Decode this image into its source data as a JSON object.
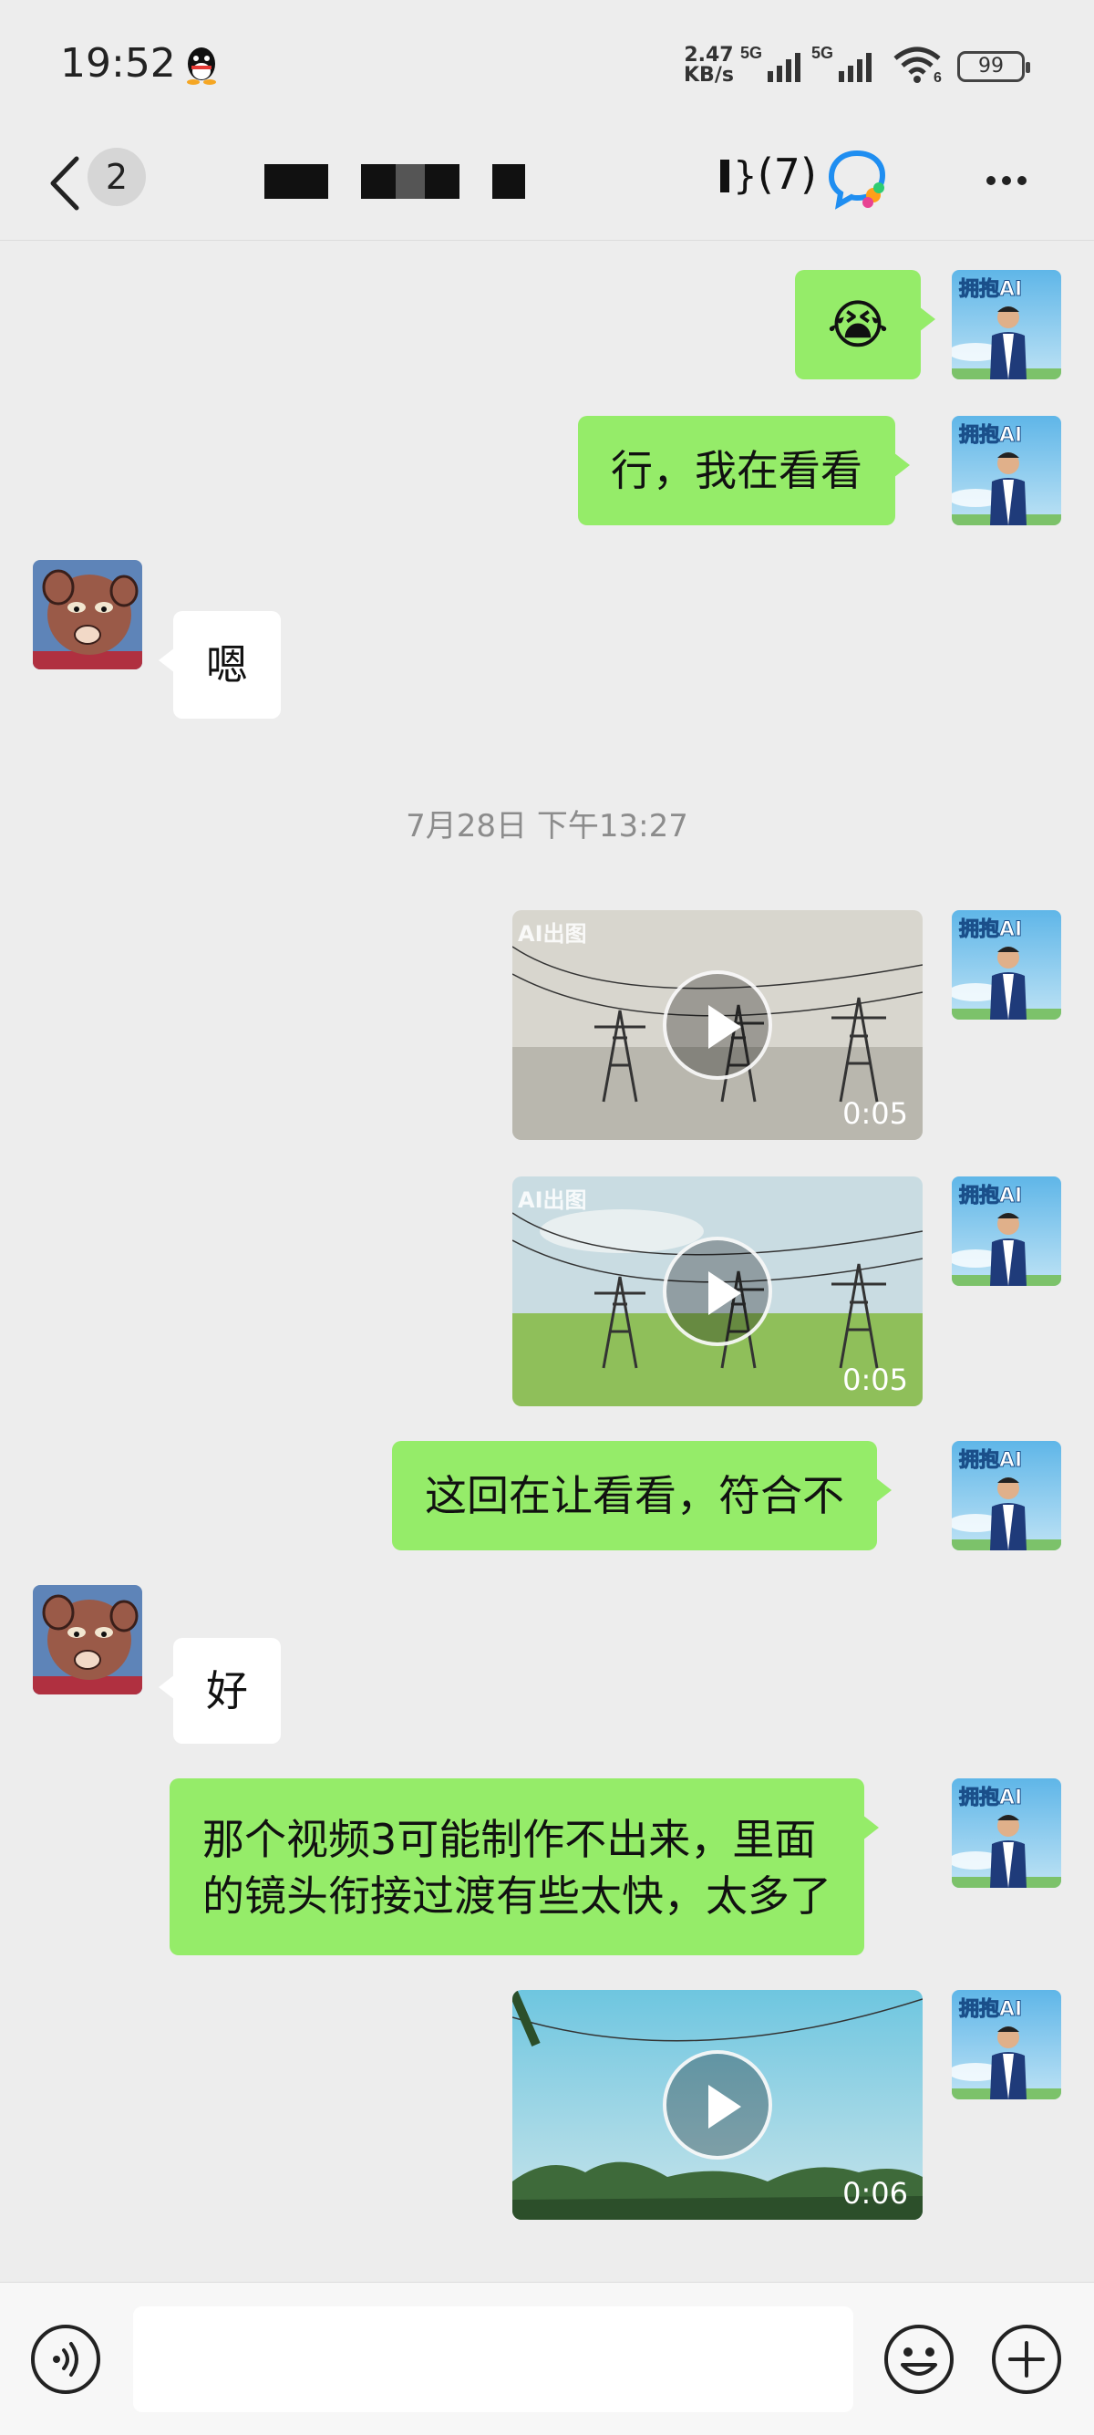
{
  "status_bar": {
    "time": "19:52",
    "net_speed_value": "2.47",
    "net_speed_unit": "KB/s",
    "sim1": "5G",
    "sim2": "5G",
    "wifi_sub": "6",
    "battery": "99"
  },
  "header": {
    "unread_count": "2",
    "title_suffix": "(7)"
  },
  "messages": [
    {
      "id": "m1",
      "side": "me",
      "type": "emoji",
      "emoji": "😭"
    },
    {
      "id": "m2",
      "side": "me",
      "type": "text",
      "text": "行，我在看看"
    },
    {
      "id": "m3",
      "side": "them",
      "type": "text",
      "text": "嗯"
    },
    {
      "id": "ts1",
      "type": "timestamp",
      "text": "7月28日 下午13:27"
    },
    {
      "id": "m4",
      "side": "me",
      "type": "video",
      "duration": "0:05",
      "watermark": "AI出图"
    },
    {
      "id": "m5",
      "side": "me",
      "type": "video",
      "duration": "0:05",
      "watermark": "AI出图"
    },
    {
      "id": "m6",
      "side": "me",
      "type": "text",
      "text": "这回在让看看，符合不"
    },
    {
      "id": "m7",
      "side": "them",
      "type": "text",
      "text": "好"
    },
    {
      "id": "m8",
      "side": "me",
      "type": "text",
      "text_line1": "那个视频3可能制作不出来，里面",
      "text_line2": "的镜头衔接过渡有些太快，太多了"
    },
    {
      "id": "m9",
      "side": "me",
      "type": "video",
      "duration": "0:06"
    }
  ],
  "my_avatar_caption": "拥抱AI",
  "colors": {
    "my_bubble": "#95ec69",
    "their_bubble": "#ffffff",
    "background": "#ededed"
  },
  "icons": {
    "back": "chevron-left-icon",
    "ai_assistant": "ai-chat-icon",
    "more": "more-icon",
    "voice": "voice-icon",
    "emoji": "emoji-icon",
    "plus": "plus-icon"
  }
}
